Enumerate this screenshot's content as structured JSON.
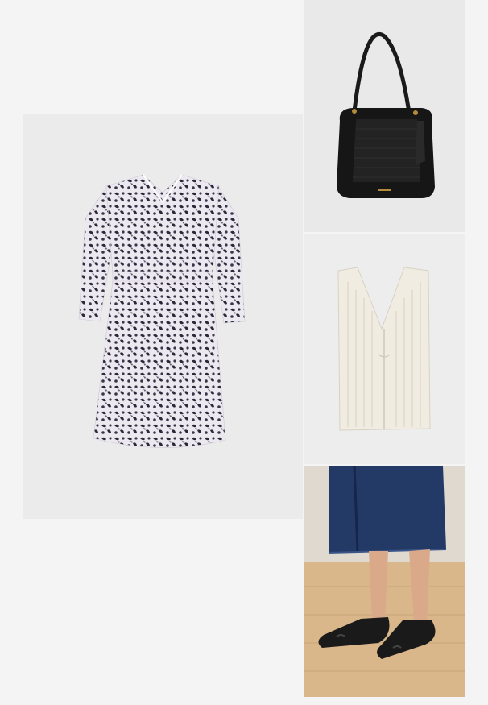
{
  "outfit": {
    "items": [
      {
        "id": "dress",
        "label": "",
        "accent": "#2e2a3a"
      },
      {
        "id": "bag",
        "label": "",
        "accent": "#1c1c1c"
      },
      {
        "id": "vest",
        "label": "",
        "accent": "#efe9dc"
      },
      {
        "id": "shoes",
        "label": "",
        "accent": "#1f2a44"
      }
    ]
  },
  "colors": {
    "page_bg": "#f4f4f4",
    "tile_bg": "#ebebeb",
    "floor": "#d9b78a",
    "denim": "#243a66"
  }
}
